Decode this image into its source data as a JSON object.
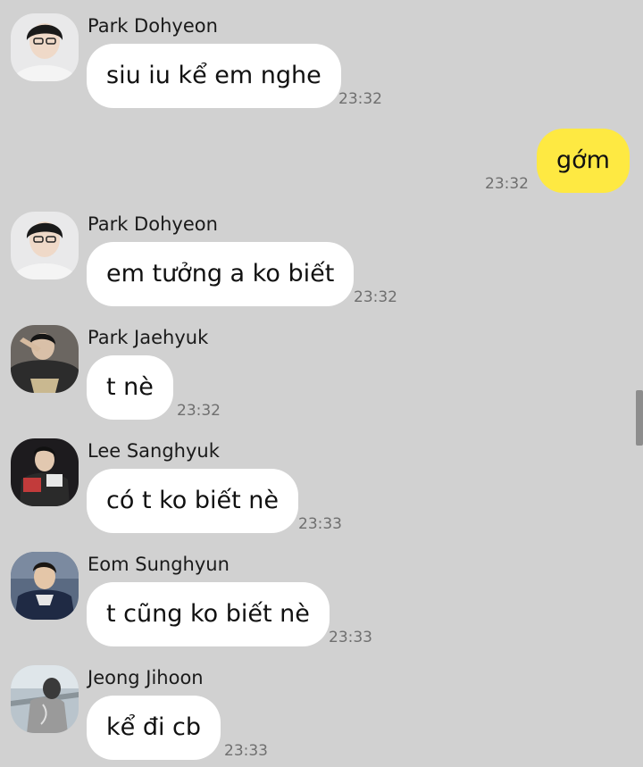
{
  "colors": {
    "background": "#d1d1d1",
    "incoming_bubble": "#ffffff",
    "outgoing_bubble": "#fee942",
    "timestamp": "#6f6f6f"
  },
  "messages": [
    {
      "sender": "Park Dohyeon",
      "text": "siu iu kể em nghe",
      "time": "23:32",
      "avatar_icon": "avatar-photo-icon"
    },
    {
      "sender": "",
      "text": "gớm",
      "time": "23:32",
      "outgoing": true
    },
    {
      "sender": "Park Dohyeon",
      "text": "em tưởng a ko biết",
      "time": "23:32",
      "avatar_icon": "avatar-photo-icon"
    },
    {
      "sender": "Park Jaehyuk",
      "text": "t nè",
      "time": "23:32",
      "avatar_icon": "avatar-photo-icon"
    },
    {
      "sender": "Lee Sanghyuk",
      "text": "có t ko biết nè",
      "time": "23:33",
      "avatar_icon": "avatar-photo-icon"
    },
    {
      "sender": "Eom Sunghyun",
      "text": "t cũng ko biết nè",
      "time": "23:33",
      "avatar_icon": "avatar-photo-icon"
    },
    {
      "sender": "Jeong Jihoon",
      "text": "kể đi cb",
      "time": "23:33",
      "avatar_icon": "avatar-photo-icon"
    }
  ]
}
